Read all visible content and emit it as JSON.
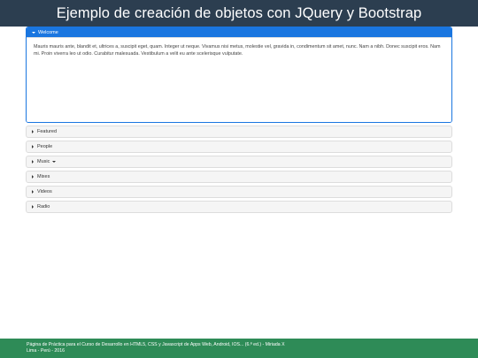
{
  "header": {
    "title": "Ejemplo de creación de objetos con JQuery y Bootstrap"
  },
  "accordion": {
    "active": {
      "label": "Welcome",
      "body": "Mauris mauris ante, blandit et, ultrices a, suscipit eget, quam. Integer ut neque. Vivamus nisi metus, molestie vel, gravida in, condimentum sit amet, nunc. Nam a nibh. Donec suscipit eros. Nam mi. Proin viverra leo ut odio. Curabitur malesuada. Vestibulum a velit eu ante scelerisque vulputate."
    },
    "items": [
      {
        "label": "Featured"
      },
      {
        "label": "People"
      },
      {
        "label": "Music"
      },
      {
        "label": "Mixes"
      },
      {
        "label": "Videos"
      },
      {
        "label": "Radio"
      }
    ]
  },
  "footer": {
    "line1": "Página de Práctica para el Curso de Desarrollo en HTML5, CSS y Javascript de Apps Web, Android, IOS... (6.ª ed.) - Miriada X",
    "line2": "Lima - Perú - 2016"
  },
  "colors": {
    "header_bg": "#2c3e50",
    "active_heading": "#1a76e0",
    "footer_bg": "#2e8b57"
  }
}
